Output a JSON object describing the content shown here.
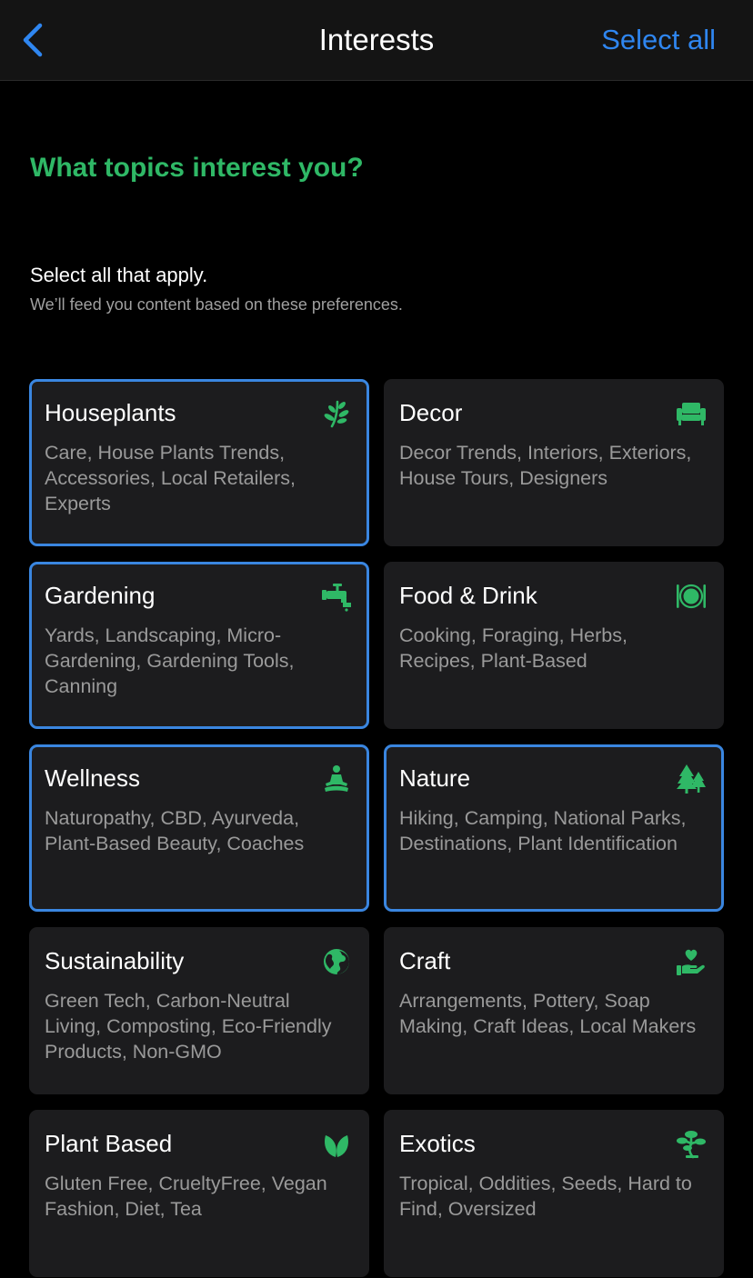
{
  "nav": {
    "title": "Interests",
    "select_all_label": "Select all",
    "back_icon": "chevron-left-icon"
  },
  "heading": "What topics interest you?",
  "instruction": "Select all that apply.",
  "subinstruction": "We’ll feed you content based on these preferences.",
  "colors": {
    "accent_green": "#2fb866",
    "accent_blue": "#2f86f0",
    "selected_border": "#3a86e0",
    "card_bg": "#1c1c1e"
  },
  "topics": [
    {
      "title": "Houseplants",
      "description": "Care, House Plants Trends, Accessories, Local Retailers, Experts",
      "icon": "seedling-icon",
      "selected": true
    },
    {
      "title": "Decor",
      "description": "Decor Trends, Interiors, Exteriors, House Tours, Designers",
      "icon": "couch-icon",
      "selected": false
    },
    {
      "title": "Gardening",
      "description": "Yards, Landscaping, Micro-Gardening, Gardening Tools, Canning",
      "icon": "faucet-icon",
      "selected": true
    },
    {
      "title": "Food & Drink",
      "description": "Cooking, Foraging, Herbs, Recipes, Plant-Based",
      "icon": "plate-utensils-icon",
      "selected": false
    },
    {
      "title": "Wellness",
      "description": "Naturopathy, CBD, Ayurveda, Plant-Based Beauty, Coaches",
      "icon": "meditation-icon",
      "selected": true
    },
    {
      "title": "Nature",
      "description": "Hiking, Camping, National Parks, Destinations, Plant Identification",
      "icon": "trees-icon",
      "selected": true
    },
    {
      "title": "Sustainability",
      "description": "Green Tech, Carbon-Neutral Living, Composting, Eco-Friendly Products, Non-GMO",
      "icon": "globe-icon",
      "selected": false
    },
    {
      "title": "Craft",
      "description": "Arrangements, Pottery, Soap Making, Craft Ideas, Local Makers",
      "icon": "hand-heart-icon",
      "selected": false
    },
    {
      "title": "Plant Based",
      "description": "Gluten Free, CrueltyFree, Vegan Fashion, Diet, Tea",
      "icon": "leaves-icon",
      "selected": false
    },
    {
      "title": "Exotics",
      "description": "Tropical, Oddities, Seeds, Hard to Find, Oversized",
      "icon": "bonsai-icon",
      "selected": false
    }
  ]
}
